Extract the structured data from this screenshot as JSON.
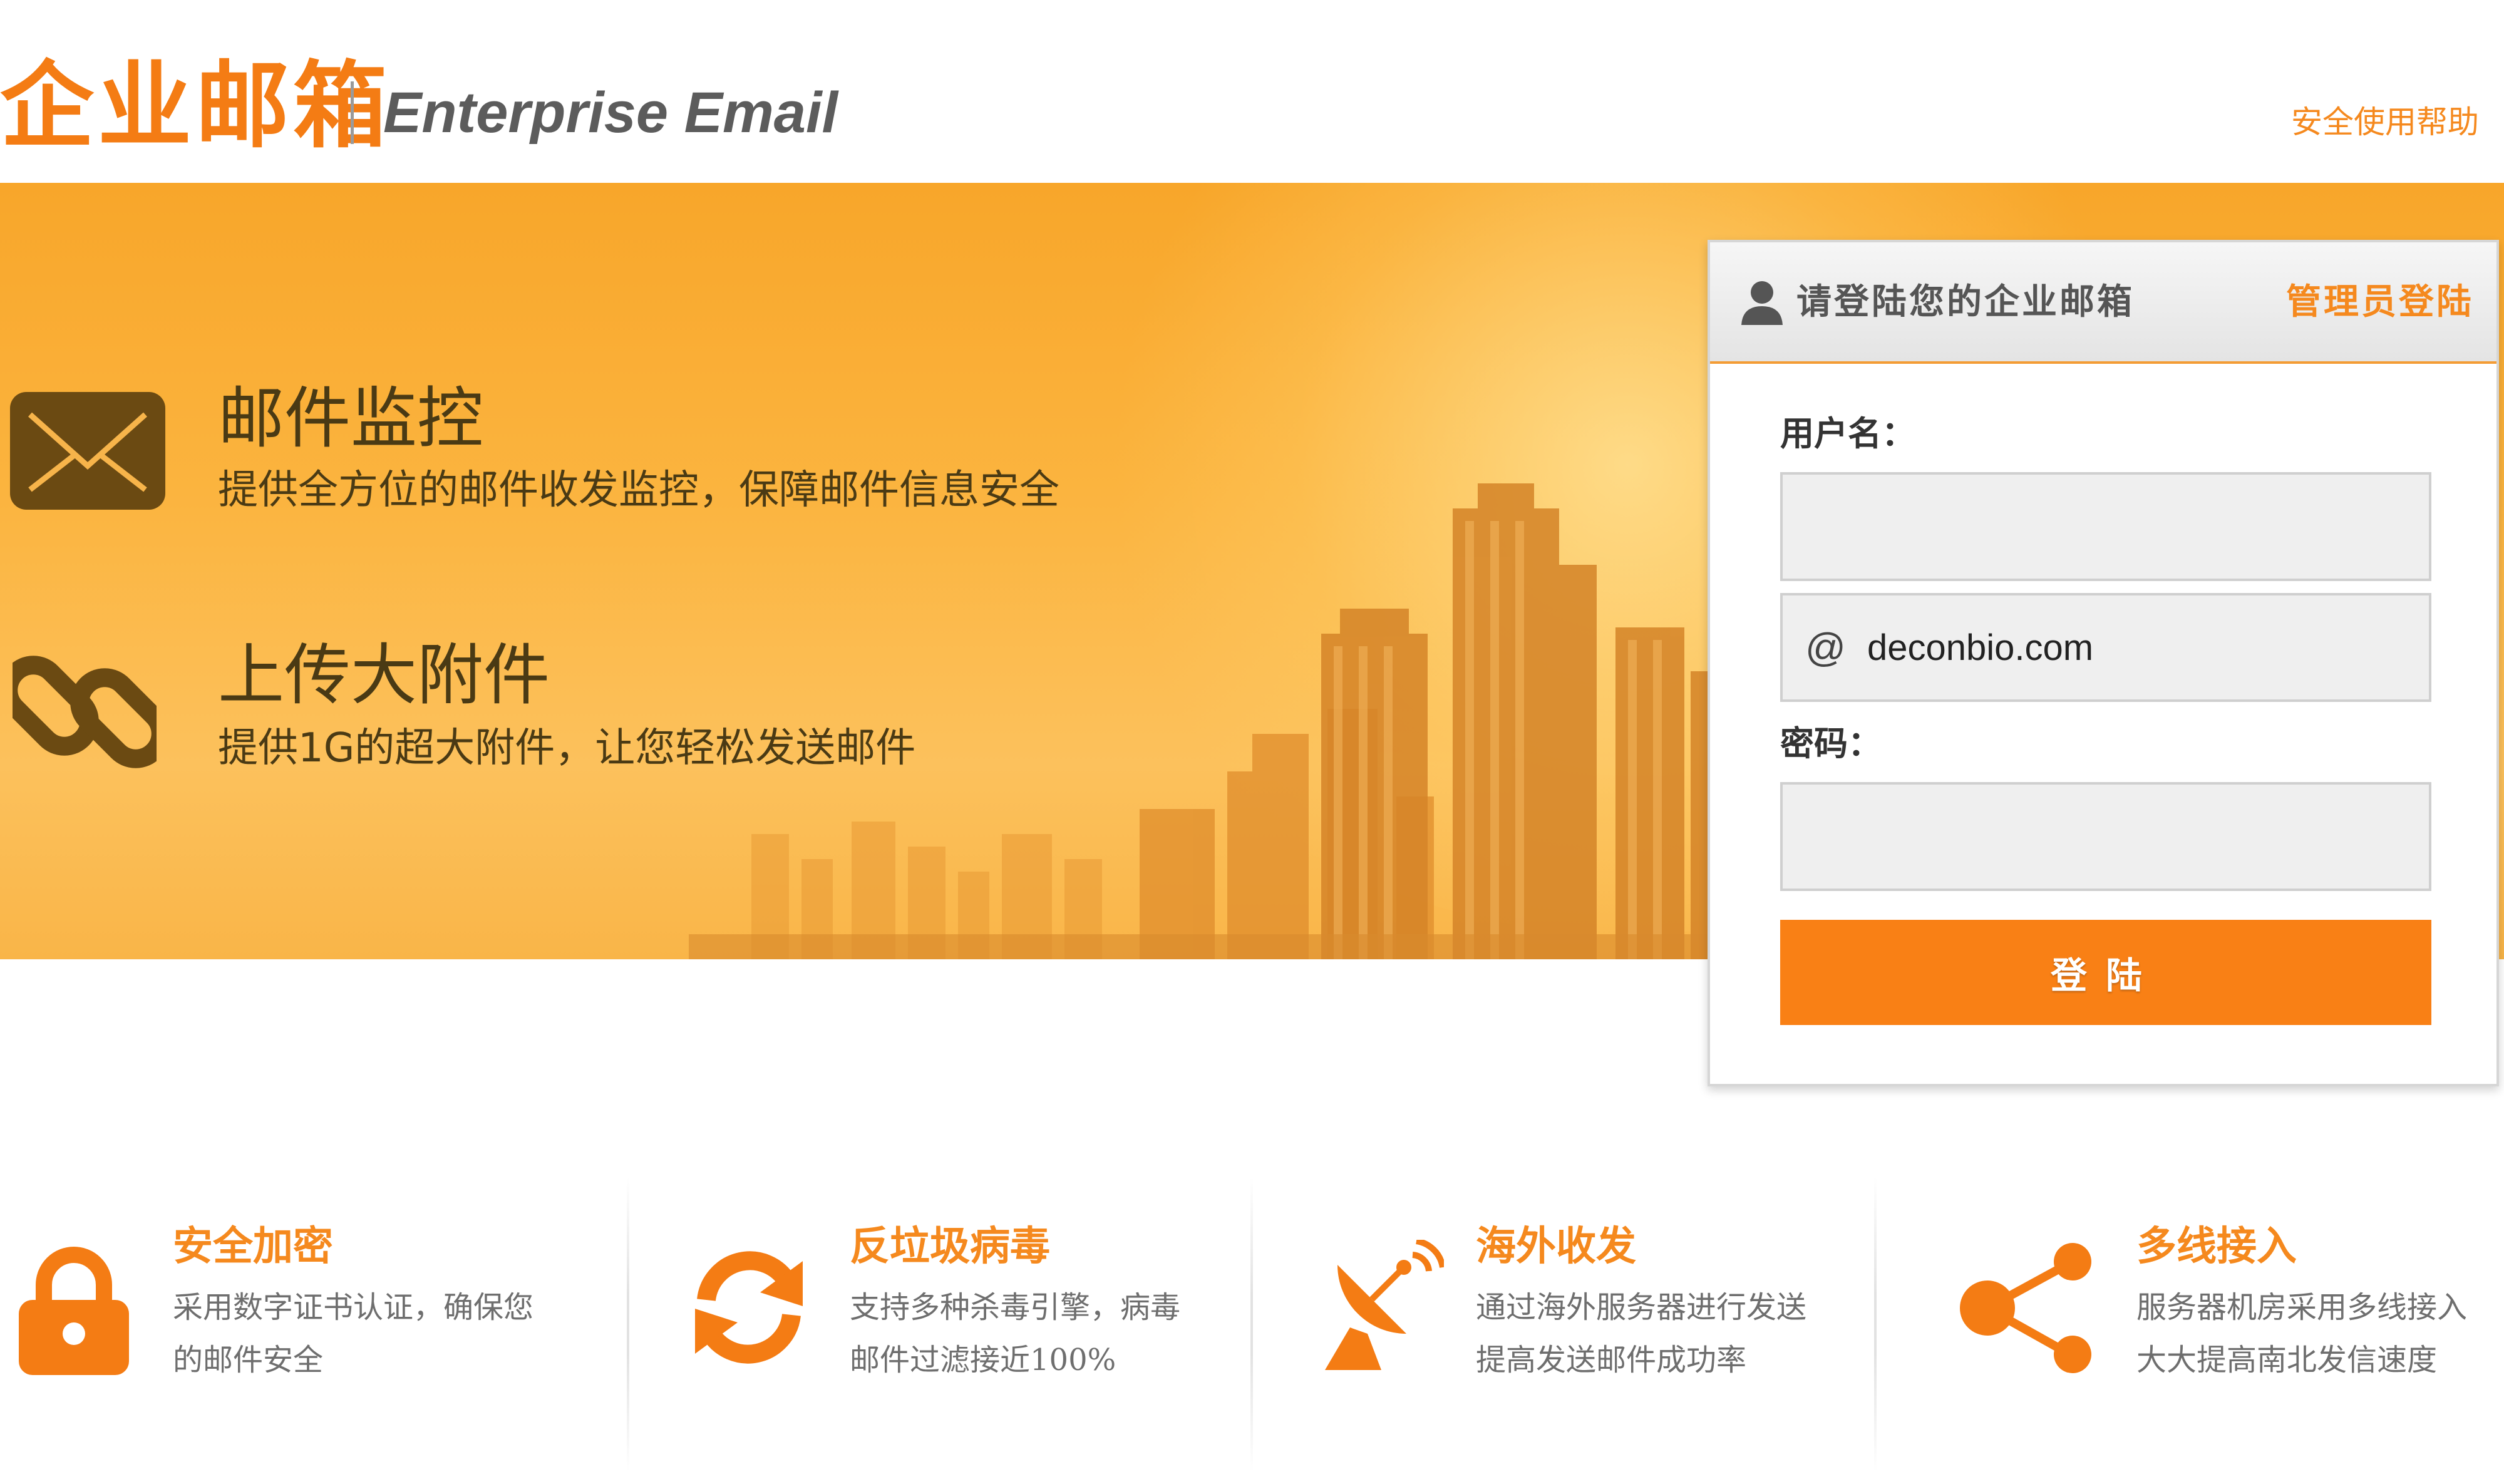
{
  "header": {
    "logo_cn": "企业邮箱",
    "logo_en": "Enterprise Email",
    "help_link": "安全使用帮助"
  },
  "banner": {
    "features": [
      {
        "icon": "envelope-icon",
        "title": "邮件监控",
        "desc": "提供全方位的邮件收发监控，保障邮件信息安全"
      },
      {
        "icon": "chain-link-icon",
        "title": "上传大附件",
        "desc": "提供1G的超大附件，让您轻松发送邮件"
      }
    ]
  },
  "login": {
    "title": "请登陆您的企业邮箱",
    "admin_link": "管理员登陆",
    "username_label": "用户名：",
    "username_value": "",
    "domain_at": "@",
    "domain": "deconbio.com",
    "password_label": "密码：",
    "password_value": "",
    "submit_label": "登陆"
  },
  "features": [
    {
      "icon": "lock-icon",
      "title": "安全加密",
      "line1": "采用数字证书认证，确保您",
      "line2": "的邮件安全"
    },
    {
      "icon": "refresh-icon",
      "title": "反垃圾病毒",
      "line1": "支持多种杀毒引擎，病毒",
      "line2": "邮件过滤接近100%"
    },
    {
      "icon": "satellite-dish-icon",
      "title": "海外收发",
      "line1": "通过海外服务器进行发送",
      "line2": "提高发送邮件成功率"
    },
    {
      "icon": "share-icon",
      "title": "多线接入",
      "line1": "服务器机房采用多线接入",
      "line2": "大大提高南北发信速度"
    }
  ],
  "colors": {
    "brand_orange": "#f47c14",
    "button_orange": "#f98015",
    "link_orange": "#f5891e",
    "banner_orange": "#fbb43f"
  }
}
